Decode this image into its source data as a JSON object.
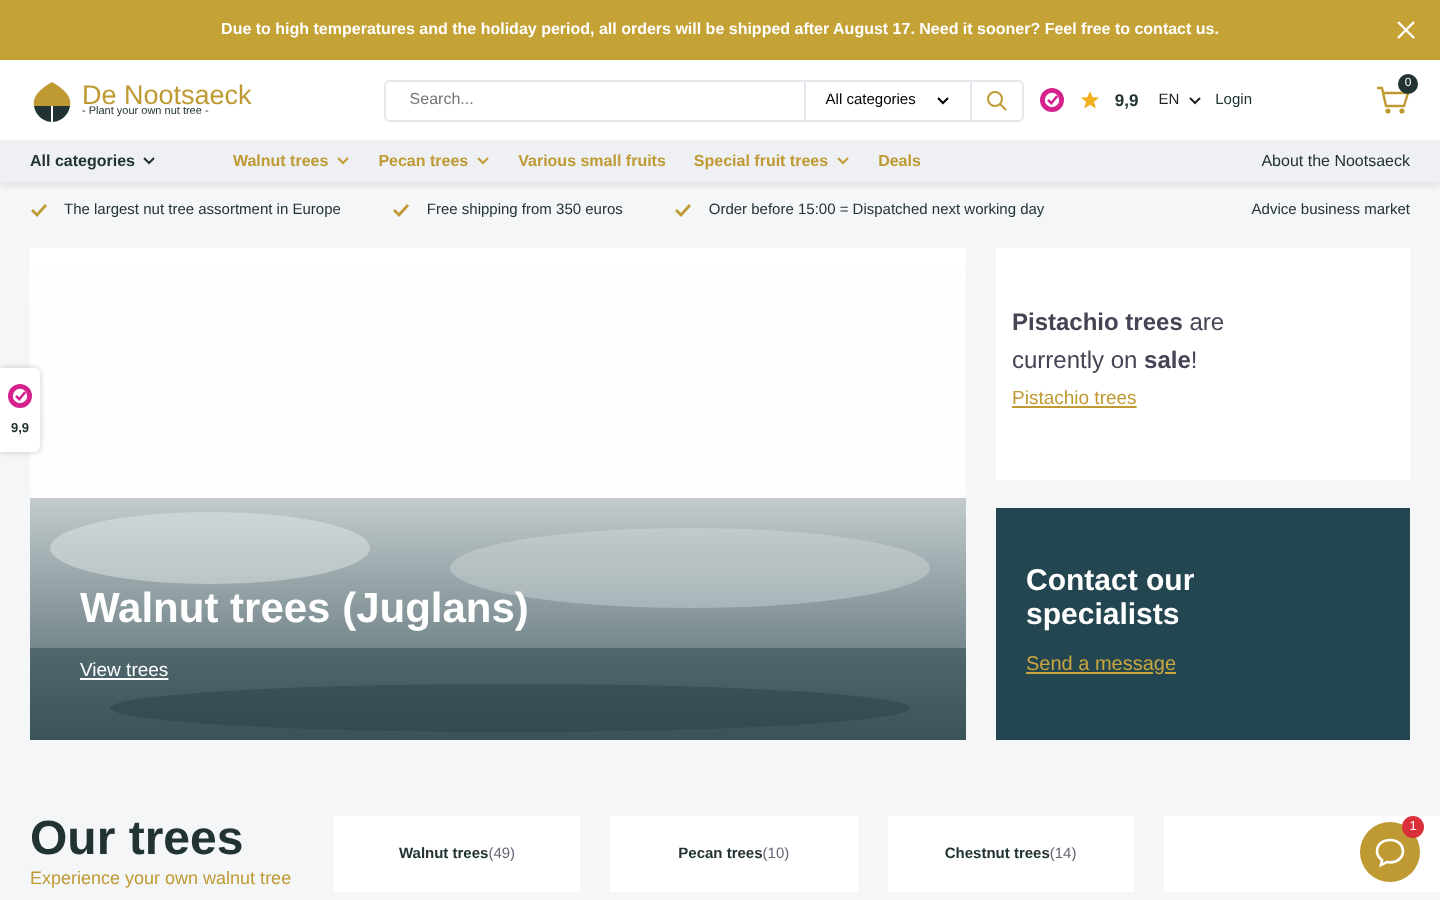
{
  "banner": {
    "text": "Due to high temperatures and the holiday period, all orders will be shipped after August 17. Need it sooner? Feel free to contact us."
  },
  "logo": {
    "name": "De Nootsaeck",
    "tagline": "- Plant your own nut tree -"
  },
  "search": {
    "placeholder": "Search...",
    "category": "All categories"
  },
  "header": {
    "rating": "9,9",
    "language": "EN",
    "login": "Login",
    "cart_count": "0"
  },
  "nav": [
    {
      "label": "All categories",
      "kind": "main",
      "dropdown": true
    },
    {
      "label": "Walnut trees",
      "kind": "category",
      "dropdown": true
    },
    {
      "label": "Pecan trees",
      "kind": "category",
      "dropdown": true
    },
    {
      "label": "Various small fruits",
      "kind": "category",
      "dropdown": false
    },
    {
      "label": "Special fruit trees",
      "kind": "category",
      "dropdown": true
    },
    {
      "label": "Deals",
      "kind": "category",
      "dropdown": false
    }
  ],
  "nav_right": "About the Nootsaeck",
  "usps": [
    "The largest nut tree assortment in Europe",
    "Free shipping from 350 euros",
    "Order before 15:00 = Dispatched next working day"
  ],
  "usp_right": "Advice business market",
  "hero": {
    "title": "Walnut trees (Juglans)",
    "link": "View trees",
    "kind": "picture"
  },
  "promo": {
    "text": "**Pistachio trees** are currently on **sale**!",
    "link": "Pistachio trees"
  },
  "contact": {
    "title": "Contact our specialists",
    "link": "Send a message"
  },
  "section": {
    "title": "Our trees",
    "subtitle": "Experience your own walnut tree"
  },
  "categories": [
    {
      "name": "Walnut trees",
      "count": "(49)"
    },
    {
      "name": "Pecan trees",
      "count": "(10)"
    },
    {
      "name": "Chestnut trees",
      "count": "(14)"
    }
  ],
  "side_rating": "9,9",
  "chat": {
    "badge": "1"
  }
}
